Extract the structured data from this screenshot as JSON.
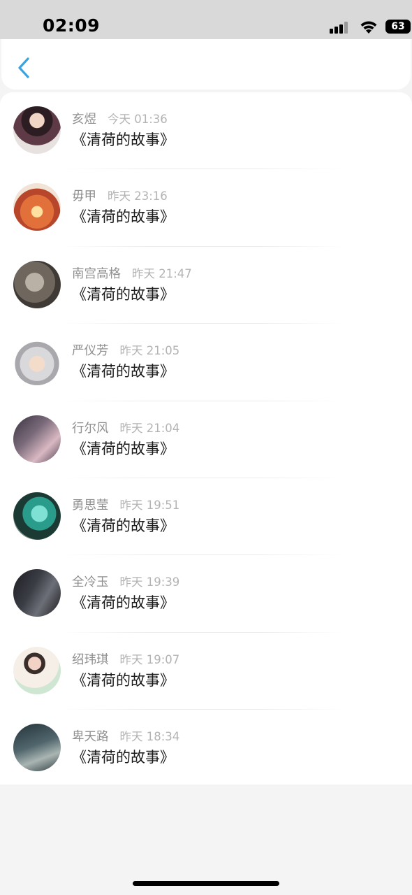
{
  "status_bar": {
    "time": "02:09",
    "battery": "63"
  },
  "nav": {
    "back_icon": "chevron-left-icon",
    "accent_color": "#3aa3e0"
  },
  "comments": [
    {
      "name": "亥煜",
      "time": "今天 01:36",
      "message": "《清荷的故事》"
    },
    {
      "name": "毋甲",
      "time": "昨天 23:16",
      "message": "《清荷的故事》"
    },
    {
      "name": "南宫高格",
      "time": "昨天 21:47",
      "message": "《清荷的故事》"
    },
    {
      "name": "严仪芳",
      "time": "昨天 21:05",
      "message": "《清荷的故事》"
    },
    {
      "name": "行尔风",
      "time": "昨天 21:04",
      "message": "《清荷的故事》"
    },
    {
      "name": "勇思莹",
      "time": "昨天 19:51",
      "message": "《清荷的故事》"
    },
    {
      "name": "全冷玉",
      "time": "昨天 19:39",
      "message": "《清荷的故事》"
    },
    {
      "name": "绍玮琪",
      "time": "昨天 19:07",
      "message": "《清荷的故事》"
    },
    {
      "name": "卑天路",
      "time": "昨天 18:34",
      "message": "《清荷的故事》"
    }
  ]
}
